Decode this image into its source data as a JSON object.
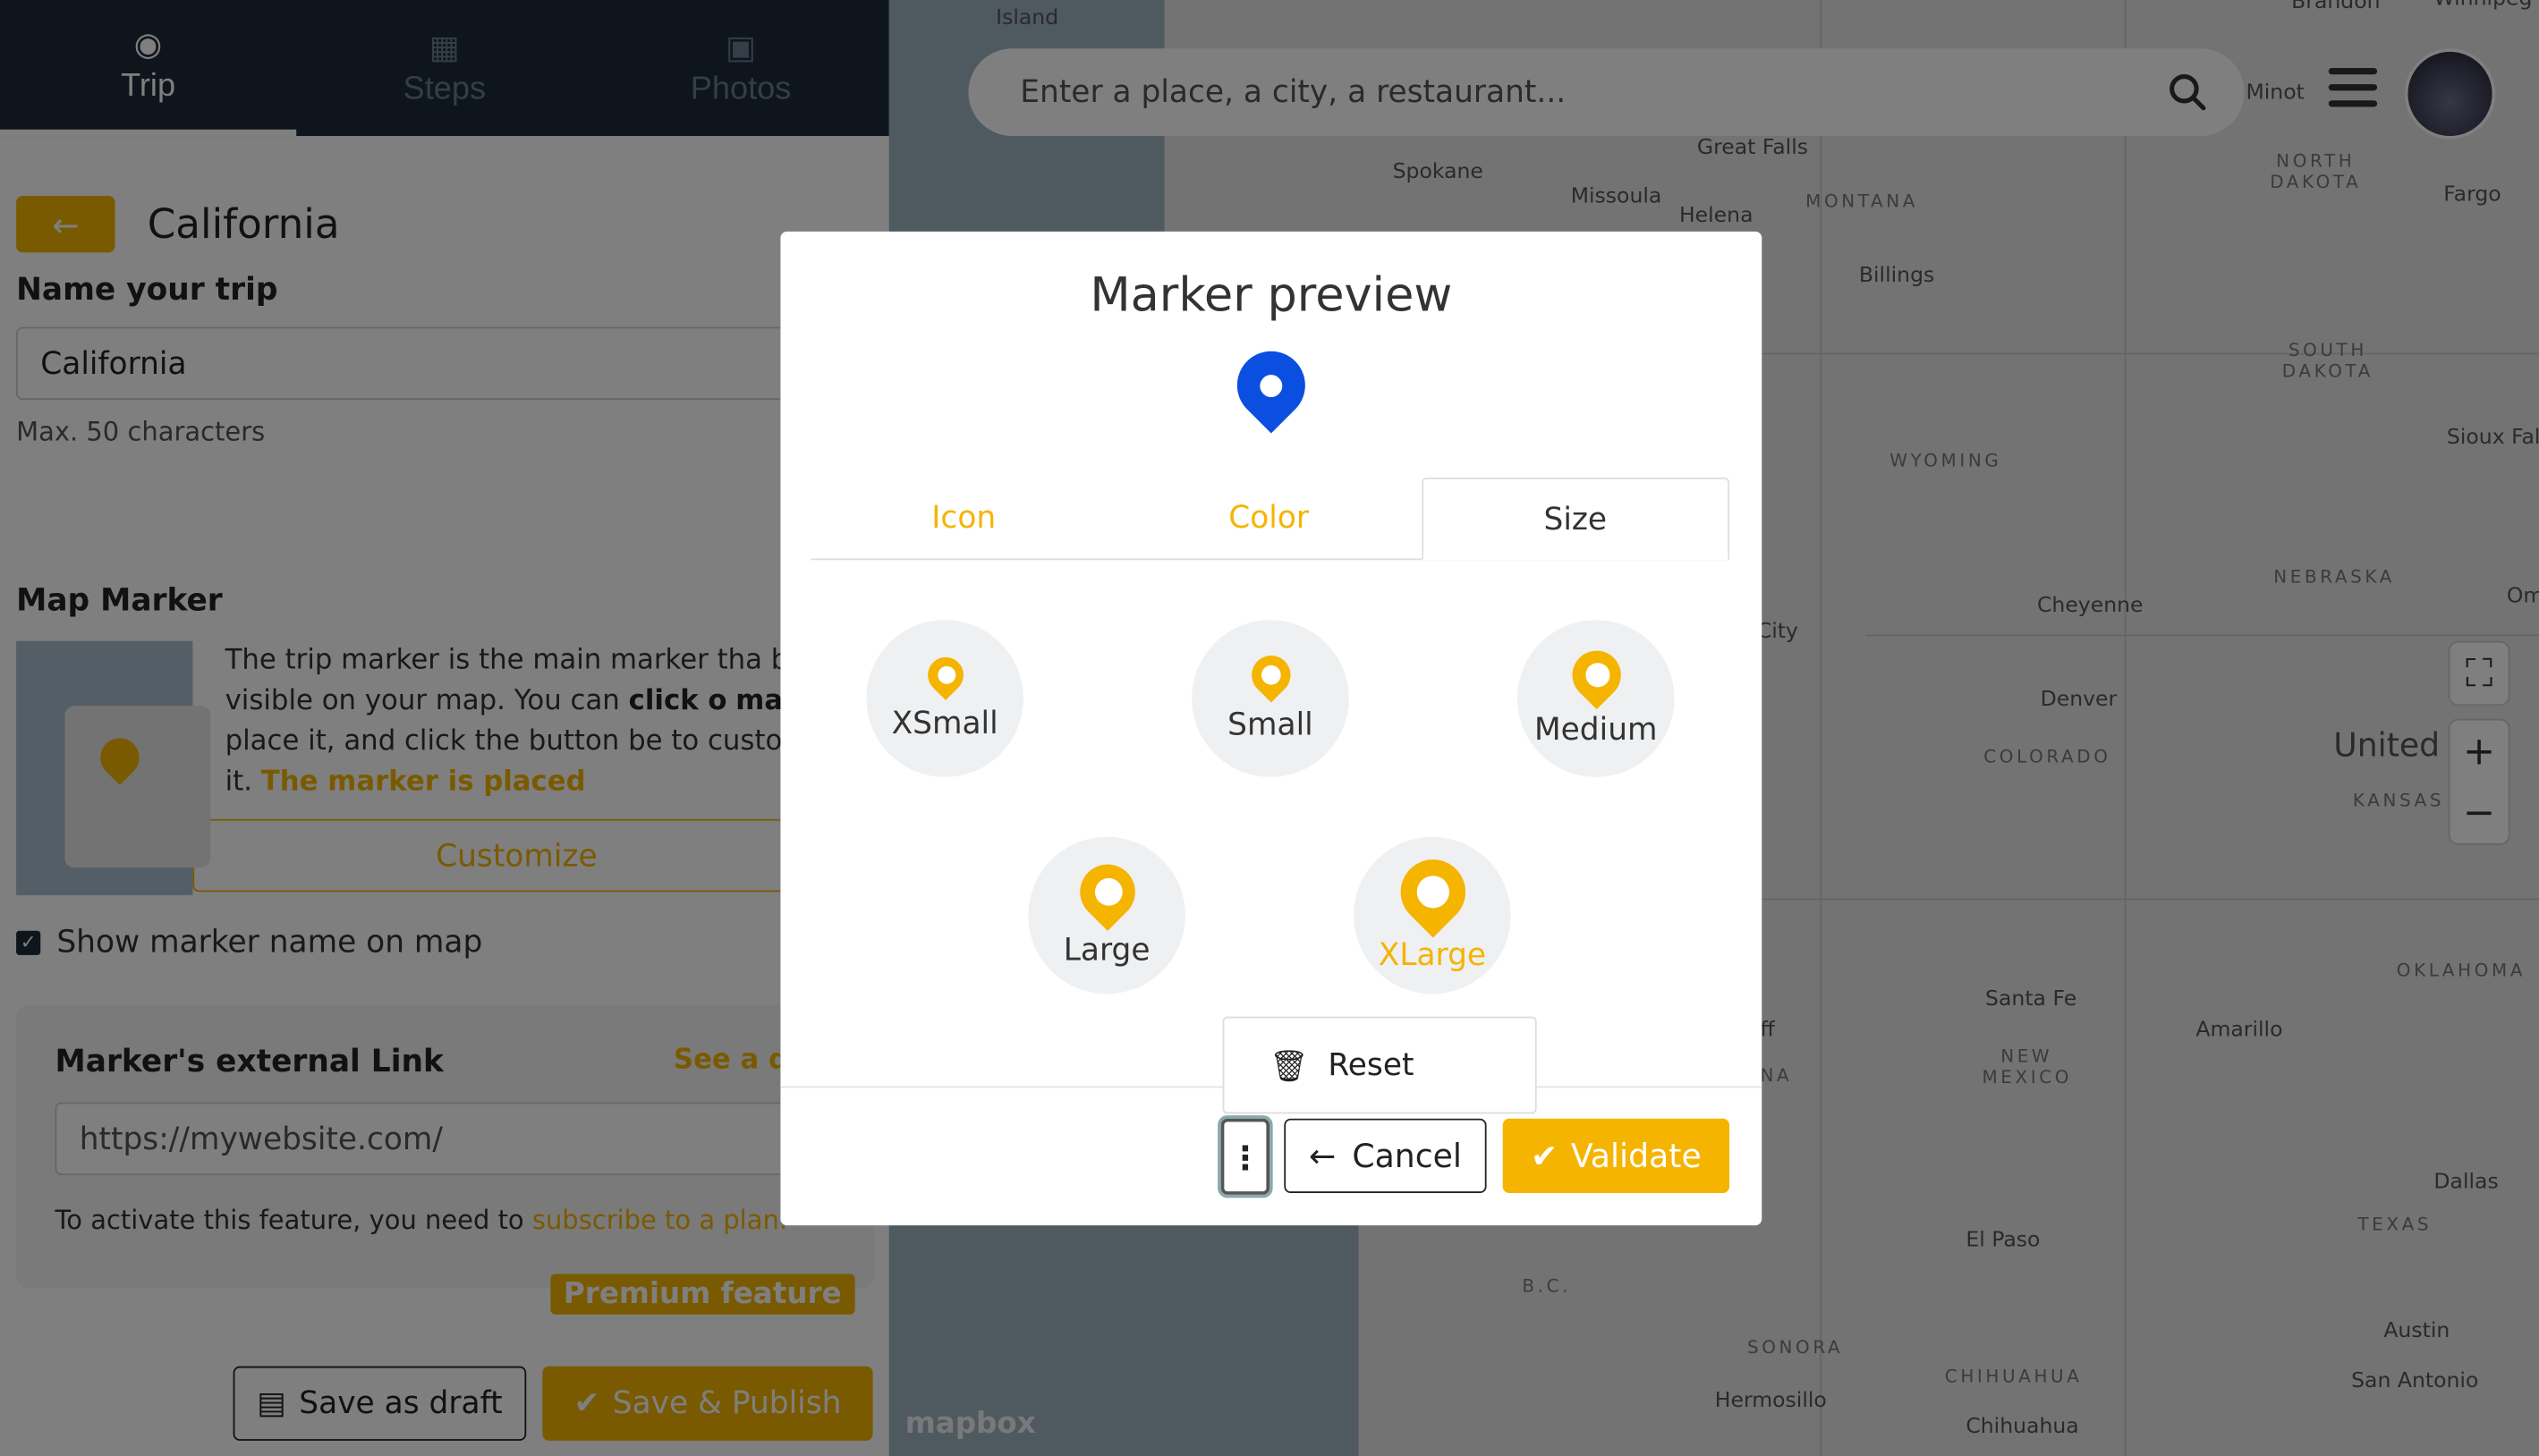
{
  "sidebar": {
    "tabs": [
      {
        "label": "Trip",
        "icon": "globe-icon",
        "active": true
      },
      {
        "label": "Steps",
        "icon": "map-icon",
        "active": false
      },
      {
        "label": "Photos",
        "icon": "camera-icon",
        "active": false
      }
    ],
    "back_icon": "←",
    "trip_title": "California",
    "name_label": "Name your trip",
    "name_value": "California",
    "name_hint": "Max. 50 characters",
    "map_marker_label": "Map Marker",
    "marker_desc": {
      "p1": "The trip marker is the main marker tha",
      "p2": " be visible on your map. You can ",
      "b1": "click o",
      "b2": "map",
      "p3": " to place it, and click the button be",
      "p4": " to customize it. ",
      "y": "The marker is placed"
    },
    "customize_label": "Customize",
    "show_name_label": "Show marker name on map",
    "external_link": {
      "title": "Marker's external Link",
      "demo": "See a dem",
      "value": "https://mywebsite.com/",
      "note": "To activate this feature, you need to ",
      "note_link": "subscribe to a plan.",
      "premium": "Premium feature"
    },
    "save_draft": "Save as draft",
    "save_publish": "Save & Publish"
  },
  "search": {
    "placeholder": "Enter a place, a city, a restaurant..."
  },
  "map": {
    "logo": "mapbox",
    "labels": [
      "Island",
      "Brandon",
      "Winnipeg",
      "Minot",
      "Spokane",
      "Great Falls",
      "Missoula",
      "Helena",
      "MONTANA",
      "NORTH DAKOTA",
      "Fargo",
      "Billings",
      "SOUTH DAKOTA",
      "WYOMING",
      "Sioux Fal",
      "NEBRASKA",
      "Cheyenne",
      "Om",
      "City",
      "Denver",
      "COLORADO",
      "United St",
      "KANSAS",
      "OKLAHOMA",
      "Santa Fe",
      "Amarillo",
      "NEW MEXICO",
      "ff",
      "NA",
      "Dallas",
      "TEXAS",
      "El Paso",
      "B.C.",
      "SONORA",
      "Austin",
      "CHIHUAHUA",
      "San Antonio",
      "Hermosillo",
      "Chihuahua"
    ]
  },
  "modal": {
    "title": "Marker preview",
    "tabs": [
      "Icon",
      "Color",
      "Size"
    ],
    "active_tab": "Size",
    "sizes": [
      "XSmall",
      "Small",
      "Medium",
      "Large",
      "XLarge"
    ],
    "selected_size": "XLarge",
    "reset_label": "Reset",
    "cancel_label": "Cancel",
    "validate_label": "Validate",
    "preview_color": "#0a4fe0",
    "accent_color": "#f5b400"
  }
}
